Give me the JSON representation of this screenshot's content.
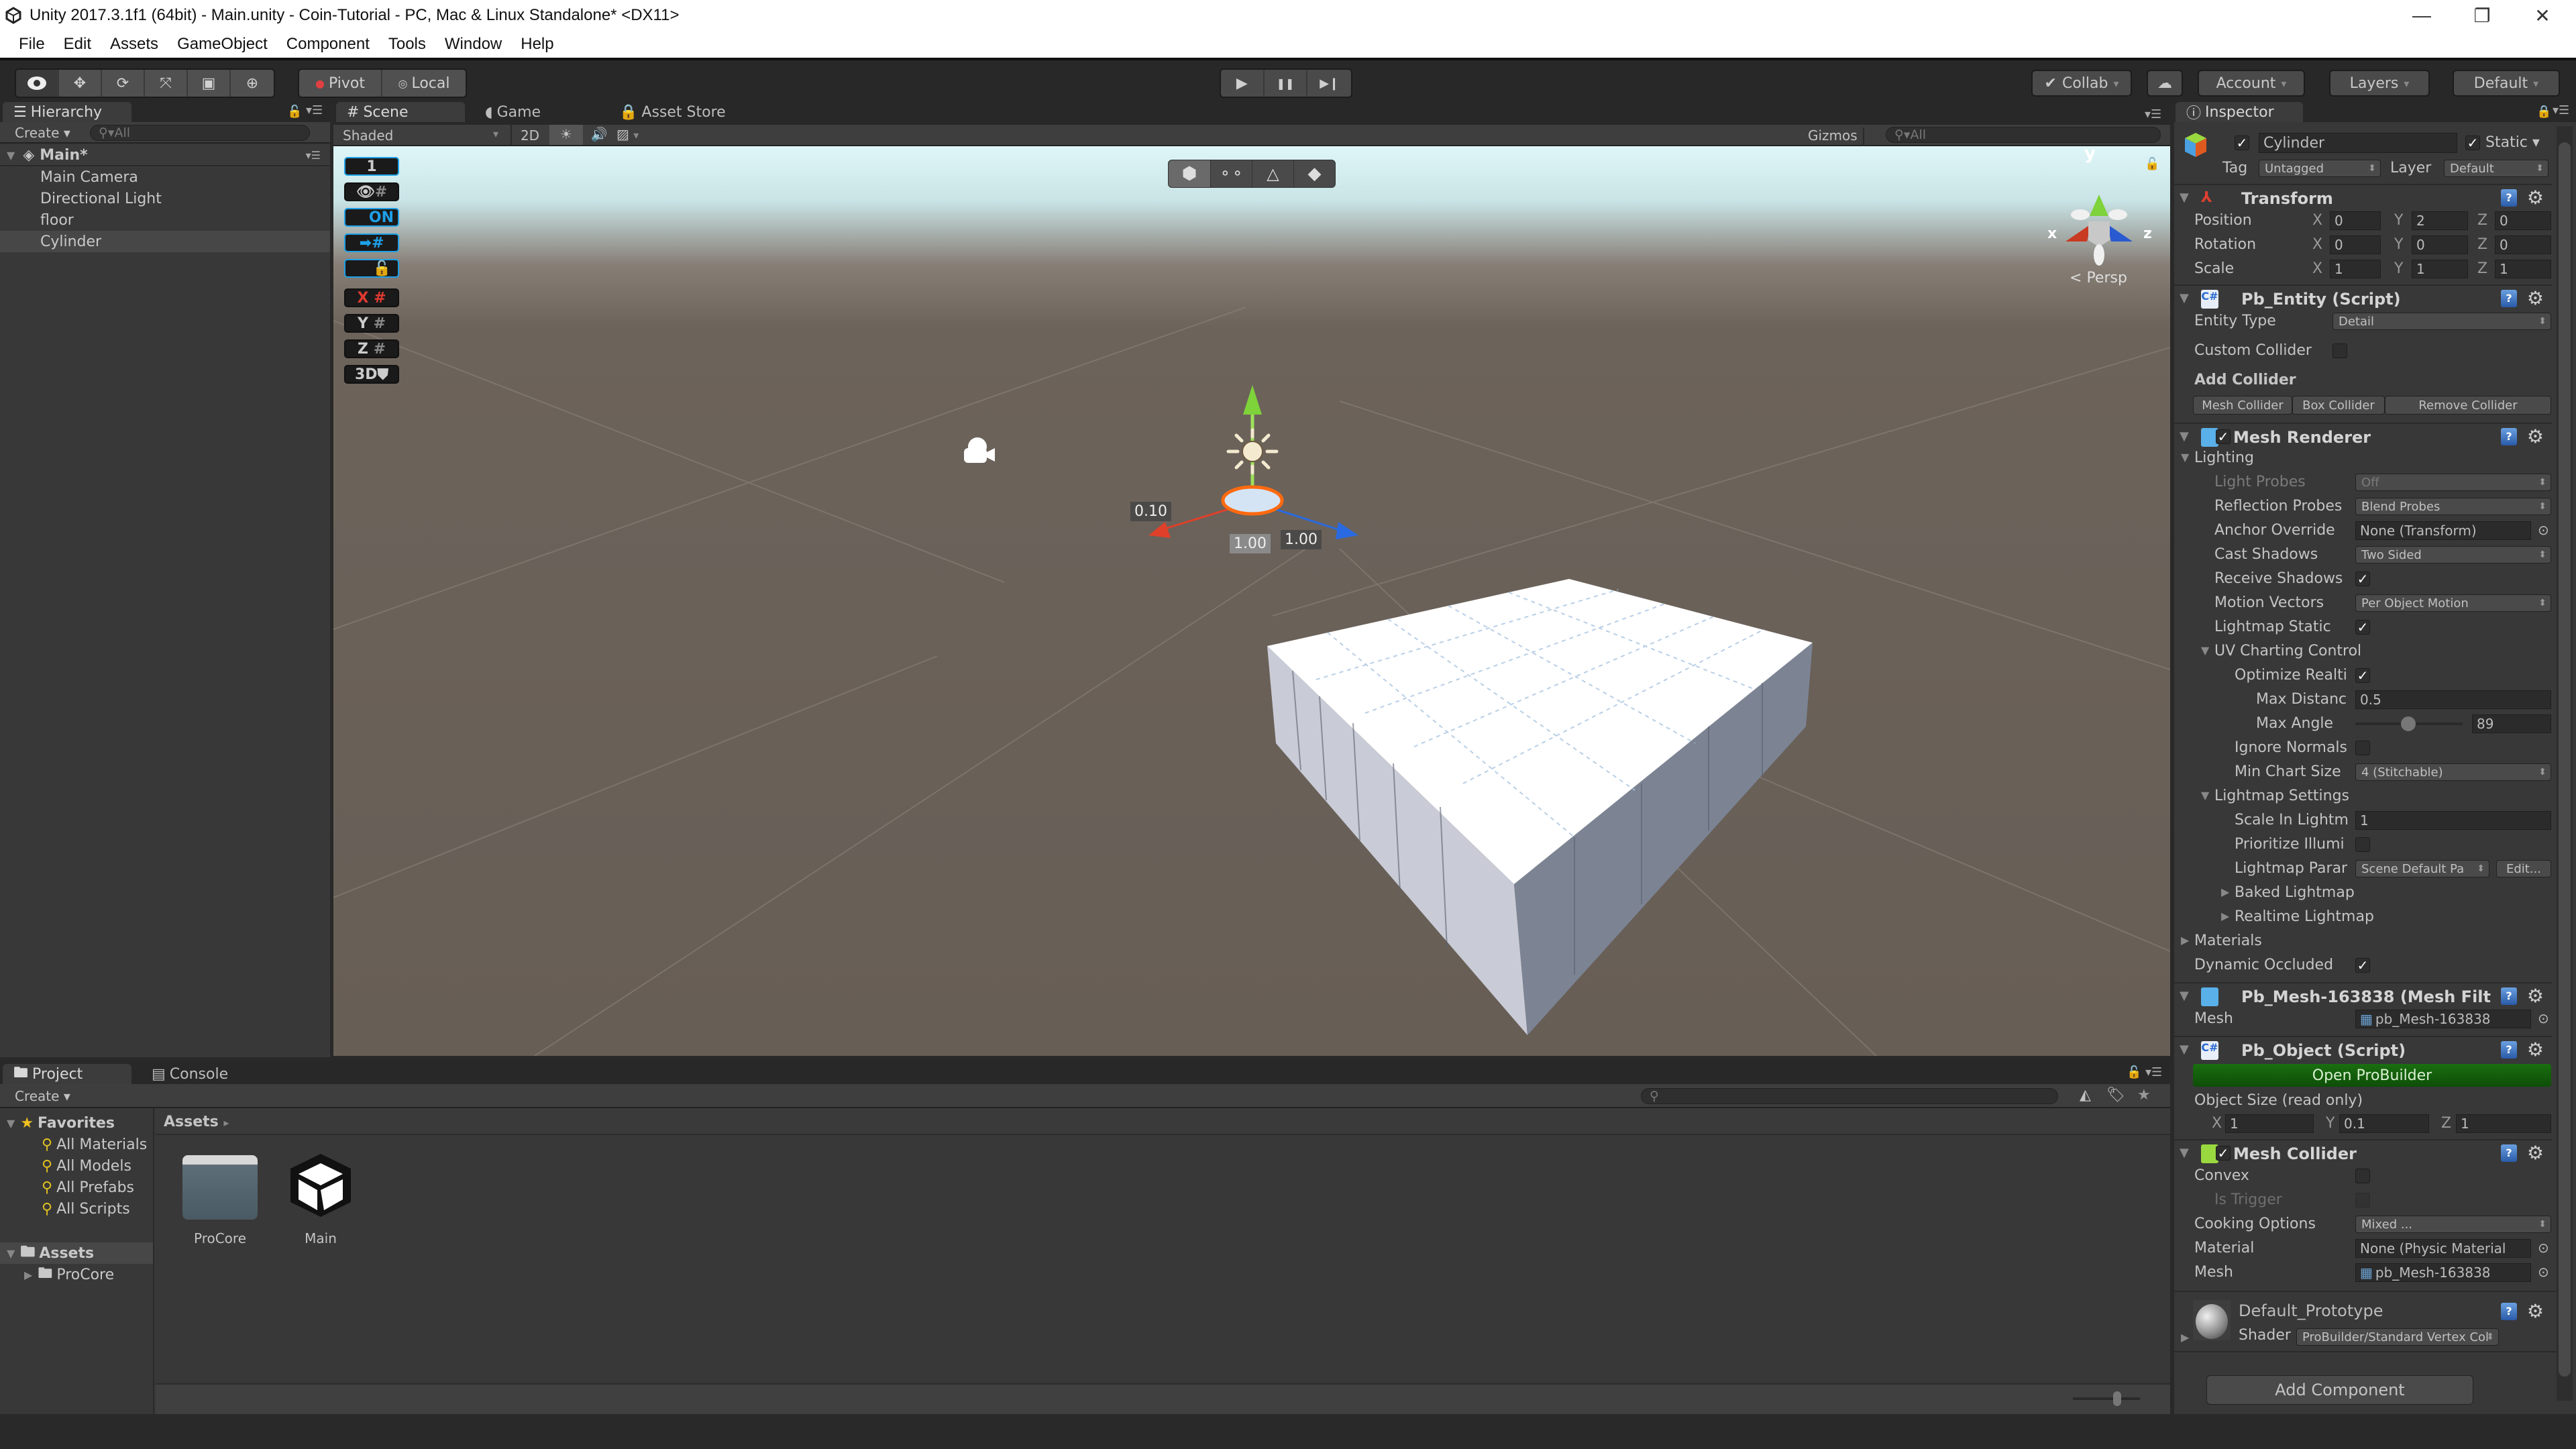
{
  "window": {
    "title": "Unity 2017.3.1f1 (64bit) - Main.unity - Coin-Tutorial - PC, Mac & Linux Standalone* <DX11>",
    "controls": {
      "minimize": "—",
      "restore": "❐",
      "close": "✕"
    }
  },
  "menu": [
    "File",
    "Edit",
    "Assets",
    "GameObject",
    "Component",
    "Tools",
    "Window",
    "Help"
  ],
  "toolbar": {
    "tools": [
      "hand-tool",
      "move-tool",
      "rotate-tool",
      "scale-tool",
      "rect-tool",
      "transform-tool"
    ],
    "pivot_label": "Pivot",
    "local_label": "Local",
    "play": "▶",
    "pause": "❚❚",
    "step": "▶❙",
    "collab_label": "Collab",
    "account_label": "Account",
    "layers_label": "Layers",
    "layout_label": "Default"
  },
  "hierarchy": {
    "tab": "Hierarchy",
    "create": "Create",
    "search_placeholder": "All",
    "scene": "Main*",
    "items": [
      "Main Camera",
      "Directional Light",
      "floor",
      "Cylinder"
    ],
    "selected": "Cylinder"
  },
  "scene": {
    "tabs": [
      "Scene",
      "Game",
      "Asset Store"
    ],
    "shading": "Shaded",
    "mode_2d": "2D",
    "gizmos": "Gizmos",
    "search_placeholder": "All",
    "persp": "Persp",
    "axes": {
      "x": "x",
      "y": "y",
      "z": "z"
    },
    "orient_panel": [
      "1",
      "ON",
      "X",
      "Y",
      "Z",
      "3D"
    ],
    "probuilder_modes": [
      "object-mode",
      "vertex-mode",
      "edge-mode",
      "face-mode"
    ],
    "handle_labels": {
      "y": "0.10",
      "x": "1.00",
      "z": "1.00"
    }
  },
  "inspector": {
    "tab": "Inspector",
    "object_name": "Cylinder",
    "active": true,
    "static": true,
    "static_label": "Static",
    "tag_label": "Tag",
    "tag": "Untagged",
    "layer_label": "Layer",
    "layer": "Default",
    "transform": {
      "title": "Transform",
      "rows": [
        {
          "label": "Position",
          "x": "0",
          "y": "2",
          "z": "0"
        },
        {
          "label": "Rotation",
          "x": "0",
          "y": "0",
          "z": "0"
        },
        {
          "label": "Scale",
          "x": "1",
          "y": "1",
          "z": "1"
        }
      ]
    },
    "pb_entity": {
      "title": "Pb_Entity (Script)",
      "entity_type_label": "Entity Type",
      "entity_type": "Detail",
      "custom_collider_label": "Custom Collider",
      "custom_collider": false,
      "add_collider_label": "Add Collider",
      "buttons": [
        "Mesh Collider",
        "Box Collider",
        "Remove Collider"
      ]
    },
    "mesh_renderer": {
      "title": "Mesh Renderer",
      "enabled": true,
      "lighting_label": "Lighting",
      "light_probes_label": "Light Probes",
      "light_probes": "Off",
      "reflection_probes_label": "Reflection Probes",
      "reflection_probes": "Blend Probes",
      "anchor_override_label": "Anchor Override",
      "anchor_override": "None (Transform)",
      "cast_shadows_label": "Cast Shadows",
      "cast_shadows": "Two Sided",
      "receive_shadows_label": "Receive Shadows",
      "receive_shadows": true,
      "motion_vectors_label": "Motion Vectors",
      "motion_vectors": "Per Object Motion",
      "lightmap_static_label": "Lightmap Static",
      "lightmap_static": true,
      "uv_charting_label": "UV Charting Control",
      "optimize_label": "Optimize Realti",
      "optimize": true,
      "max_distance_label": "Max Distanc",
      "max_distance": "0.5",
      "max_angle_label": "Max Angle",
      "max_angle": "89",
      "max_angle_fraction": 0.49,
      "ignore_normals_label": "Ignore Normals",
      "ignore_normals": false,
      "min_chart_label": "Min Chart Size",
      "min_chart": "4 (Stitchable)",
      "lightmap_settings_label": "Lightmap Settings",
      "scale_lightmap_label": "Scale In Lightm",
      "scale_lightmap": "1",
      "prioritize_label": "Prioritize Illumi",
      "prioritize": false,
      "lightmap_params_label": "Lightmap Parar",
      "lightmap_params": "Scene Default Pa",
      "edit_label": "Edit...",
      "baked_lightmap_label": "Baked Lightmap",
      "realtime_lightmap_label": "Realtime Lightmap",
      "materials_label": "Materials",
      "dynamic_occluded_label": "Dynamic Occluded",
      "dynamic_occluded": true
    },
    "mesh_filter": {
      "title": "Pb_Mesh-163838 (Mesh Filt",
      "mesh_label": "Mesh",
      "mesh": "pb_Mesh-163838"
    },
    "pb_object": {
      "title": "Pb_Object (Script)",
      "open_button": "Open ProBuilder",
      "size_label": "Object Size (read only)",
      "x": "1",
      "y": "0.1",
      "z": "1"
    },
    "mesh_collider": {
      "title": "Mesh Collider",
      "enabled": true,
      "convex_label": "Convex",
      "convex": false,
      "trigger_label": "Is Trigger",
      "trigger": false,
      "cooking_label": "Cooking Options",
      "cooking": "Mixed ...",
      "material_label": "Material",
      "material": "None (Physic Material",
      "mesh_label": "Mesh",
      "mesh": "pb_Mesh-163838"
    },
    "material": {
      "name": "Default_Prototype",
      "shader_label": "Shader",
      "shader": "ProBuilder/Standard Vertex Col"
    },
    "add_component": "Add Component"
  },
  "project": {
    "tabs": [
      "Project",
      "Console"
    ],
    "create": "Create",
    "favorites_label": "Favorites",
    "favorites": [
      "All Materials",
      "All Models",
      "All Prefabs",
      "All Scripts"
    ],
    "assets_label": "Assets",
    "asset_tree": [
      "ProCore"
    ],
    "breadcrumb": "Assets",
    "assets": [
      {
        "name": "ProCore",
        "icon": "folder-icon"
      },
      {
        "name": "Main",
        "icon": "unity-scene-icon"
      }
    ]
  },
  "colors": {
    "accent_blue": "#1ea0e8",
    "probuilder_green": "#1a6e10",
    "axis_x": "#e0402a",
    "axis_y": "#7ed23a",
    "axis_z": "#2a6ae0"
  }
}
